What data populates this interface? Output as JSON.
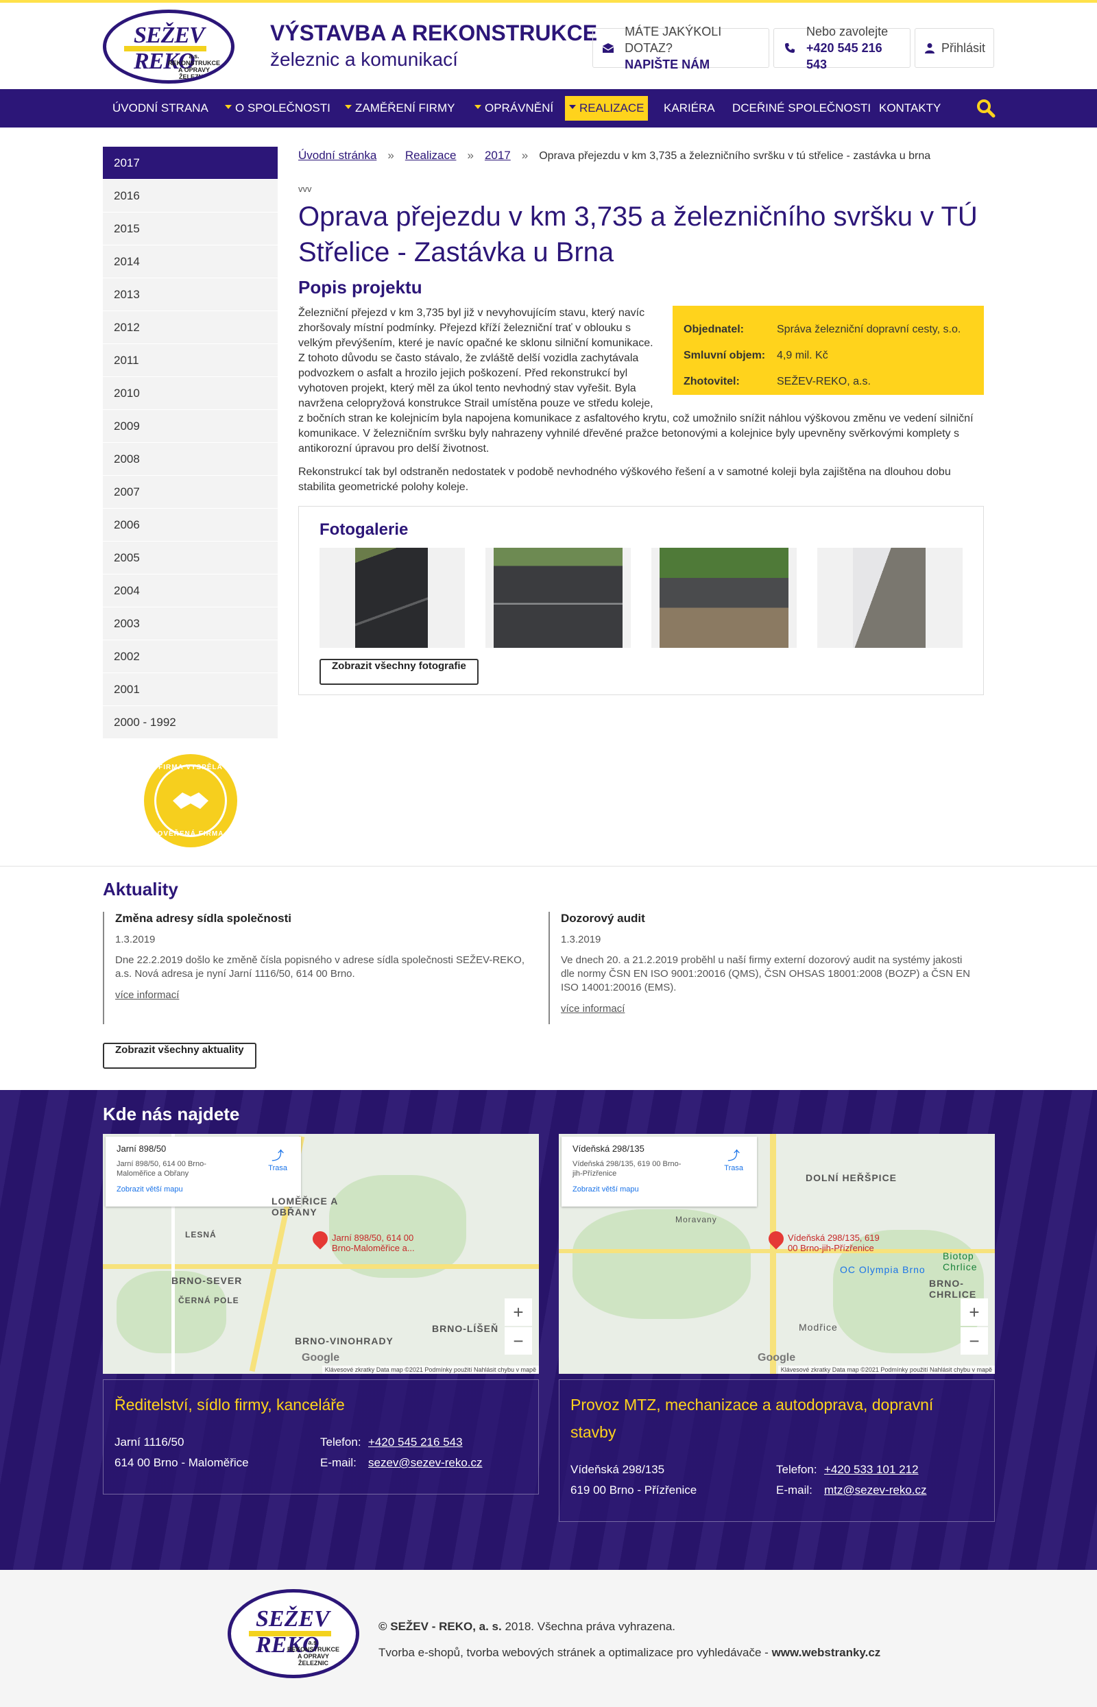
{
  "brand": {
    "line1": "VÝSTAVBA A REKONSTRUKCE",
    "line2": "železnic a komunikací",
    "logo_text": "SEŽEV REKO",
    "logo_sub": "a.s. REKONSTRUKCE A OPRAVY ŽELEZNIC",
    "accent": "#2c1678",
    "yellow": "#ffd31c"
  },
  "header": {
    "ask_label": "MÁTE JAKÝKOLI DOTAZ?",
    "ask_action": "NAPIŠTE NÁM",
    "call_label": "Nebo zavolejte",
    "call_number": "+420 545 216 543",
    "login": "Přihlásit"
  },
  "nav": {
    "items": [
      "ÚVODNÍ STRANA",
      "O SPOLEČNOSTI",
      "ZAMĚŘENÍ FIRMY",
      "OPRÁVNĚNÍ",
      "REALIZACE",
      "KARIÉRA",
      "DCEŘINÉ SPOLEČNOSTI",
      "KONTAKTY"
    ],
    "active": "REALIZACE"
  },
  "sidebar": {
    "years": [
      "2017",
      "2016",
      "2015",
      "2014",
      "2013",
      "2012",
      "2011",
      "2010",
      "2009",
      "2008",
      "2007",
      "2006",
      "2005",
      "2004",
      "2003",
      "2002",
      "2001",
      "2000 - 1992"
    ],
    "active": "2017",
    "badge_top": "FIRMA VYSPĚLÁ",
    "badge_bottom": "OVĚŘENÁ FIRMA"
  },
  "breadcrumb": [
    "Úvodní stránka",
    "Realizace",
    "2017",
    "Oprava přejezdu v km 3,735 a železničního svršku v tú střelice - zastávka u brna"
  ],
  "article": {
    "tag": "vvv",
    "title": "Oprava přejezdu v km 3,735 a železničního svršku v TÚ Střelice - Zastávka u Brna",
    "section": "Popis projektu",
    "p1": "Železniční přejezd v km 3,735 byl již v nevyhovujícím stavu, který navíc zhoršovaly místní podmínky. Přejezd kříží železniční trať v oblouku s velkým převýšením, které je navíc opačné ke sklonu silniční komunikace. Z tohoto důvodu se často stávalo, že zvláště delší vozidla zachytávala podvozkem o asfalt a hrozilo jejich poškození. Před rekonstrukcí byl vyhotoven projekt, který měl za úkol tento nevhodný stav vyřešit. Byla navržena celopryžová konstrukce Strail umístěna pouze ve středu koleje, z bočních stran ke kolejnicím byla napojena komunikace z asfaltového krytu, což umožnilo snížit náhlou výškovou změnu ve vedení silniční komunikace. V železničním svršku byly nahrazeny vyhnilé dřevěné pražce betonovými a kolejnice byly upevněny svěrkovými komplety s antikorozní úpravou pro delší životnost.",
    "p2": "Rekonstrukcí tak byl odstraněn nedostatek v podobě nevhodného výškového řešení a v samotné koleji byla zajištěna na dlouhou dobu stabilita geometrické polohy koleje.",
    "info": [
      {
        "k": "Objednatel:",
        "v": "Správa železniční dopravní cesty, s.o."
      },
      {
        "k": "Smluvní objem:",
        "v": "4,9 mil. Kč"
      },
      {
        "k": "Zhotovitel:",
        "v": "SEŽEV-REKO, a.s."
      }
    ]
  },
  "gallery": {
    "title": "Fotogalerie",
    "button": "Zobrazit všechny fotografie"
  },
  "news": {
    "title": "Aktuality",
    "items": [
      {
        "title": "Změna adresy sídla společnosti",
        "date": "1.3.2019",
        "text": "Dne 22.2.2019 došlo ke změně čísla popisného v adrese sídla společnosti SEŽEV-REKO, a.s. Nová adresa je nyní Jarní 1116/50, 614 00 Brno.",
        "link": "více informací"
      },
      {
        "title": "Dozorový audit",
        "date": "1.3.2019",
        "text": "Ve dnech 20. a 21.2.2019 proběhl u naší firmy externí dozorový audit na systémy jakosti dle normy ČSN EN ISO 9001:20016 (QMS), ČSN OHSAS 18001:2008 (BOZP) a ČSN EN ISO 14001:20016 (EMS).",
        "link": "více informací"
      }
    ],
    "button": "Zobrazit všechny aktuality"
  },
  "locations": {
    "title": "Kde nás najdete",
    "maps": [
      {
        "card_title": "Jarní 898/50",
        "card_addr": "Jarní 898/50, 614 00 Brno-Maloměřice a Obřany",
        "card_link": "Zobrazit větší mapu",
        "route": "Trasa",
        "pin": "Jarní 898/50, 614 00 Brno-Maloměřice a...",
        "labels": [
          "LOMĚŘICE A OBŘANY",
          "BRNO-SEVER",
          "BRNO-VINOHRADY",
          "BRNO-LÍŠEŇ",
          "LESNÁ",
          "ČERNÁ POLE"
        ],
        "footer": "Klávesové zkratky   Data map ©2021   Podmínky použití   Nahlásit chybu v mapě"
      },
      {
        "card_title": "Vídeňská 298/135",
        "card_addr": "Vídeňská 298/135, 619 00 Brno-jih-Přízřenice",
        "card_link": "Zobrazit větší mapu",
        "route": "Trasa",
        "pin": "Vídeňská 298/135, 619 00 Brno-jih-Přízřenice",
        "labels": [
          "DOLNÍ HEŘŠPICE",
          "OC Olympia Brno",
          "BRNO-CHRLICE",
          "Modřice",
          "Moravany",
          "Biotop Chrlice"
        ],
        "footer": "Klávesové zkratky   Data map ©2021   Podmínky použití   Nahlásit chybu v mapě"
      }
    ],
    "offices": [
      {
        "title": "Ředitelství, sídlo firmy, kanceláře",
        "street": "Jarní 1116/50",
        "city": "614 00 Brno - Maloměřice",
        "phone_label": "Telefon:",
        "phone": "+420 545 216 543",
        "email_label": "E-mail:",
        "email": "sezev@sezev-reko.cz"
      },
      {
        "title": "Provoz MTZ, mechanizace a autodoprava, dopravní stavby",
        "street": "Vídeňská 298/135",
        "city": "619 00 Brno - Přízřenice",
        "phone_label": "Telefon:",
        "phone": "+420 533 101 212",
        "email_label": "E-mail:",
        "email": "mtz@sezev-reko.cz"
      }
    ]
  },
  "footer": {
    "copyright_strong": "© SEŽEV - REKO, a. s.",
    "copyright_rest": " 2018. Všechna práva vyhrazena.",
    "credit": "Tvorba e-shopů, tvorba webových stránek a optimalizace pro vyhledávače - ",
    "credit_link": "www.webstranky.cz"
  }
}
